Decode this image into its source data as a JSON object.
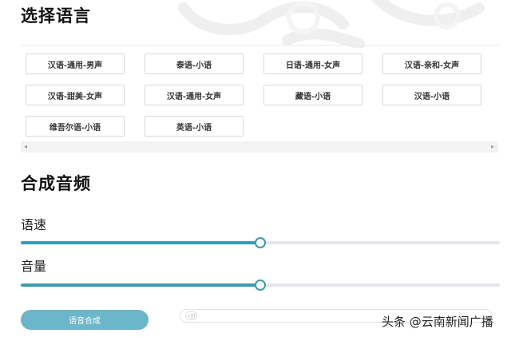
{
  "headings": {
    "select_language": "选择语言",
    "synthesize_audio": "合成音频"
  },
  "languages": [
    "汉语-通用-男声",
    "泰语-小语",
    "日语-通用-女声",
    "汉语-亲和-女声",
    "汉语-甜美-女声",
    "汉语-通用-女声",
    "藏语-小语",
    "汉语-小语",
    "维吾尔语-小语",
    "英语-小语"
  ],
  "params": {
    "speed_label": "语速",
    "volume_label": "音量",
    "speed_value_fraction": 0.5,
    "volume_value_fraction": 0.5
  },
  "actions": {
    "synthesize_button": "语音合成"
  },
  "audio_player": {
    "play_icon": "speaker-icon"
  },
  "watermark": "头条 @云南新闻广播",
  "colors": {
    "accent": "#3a9bb0",
    "button": "#6bb6c8",
    "track": "#e4e6ea"
  },
  "icons": {
    "scroll_left": "◂",
    "scroll_right": "▸",
    "speaker": "◁))"
  }
}
